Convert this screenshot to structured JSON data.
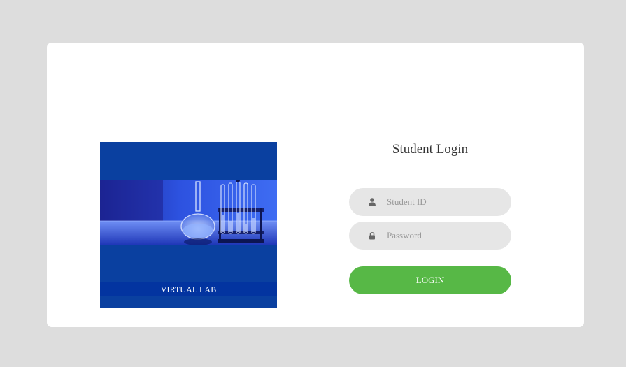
{
  "hero": {
    "caption": "VIRTUAL LAB",
    "image": "laboratory-glassware-image"
  },
  "form": {
    "title": "Student Login",
    "student_id": {
      "placeholder": "Student ID",
      "value": "",
      "icon": "user-icon"
    },
    "password": {
      "placeholder": "Password",
      "value": "",
      "icon": "lock-icon"
    },
    "login_label": "LOGIN"
  },
  "colors": {
    "page_background": "#dddddd",
    "card_background": "#ffffff",
    "hero_background": "#0a40a0",
    "caption_background": "#0334a0",
    "field_background": "#e6e6e6",
    "login_button": "#57b846"
  }
}
